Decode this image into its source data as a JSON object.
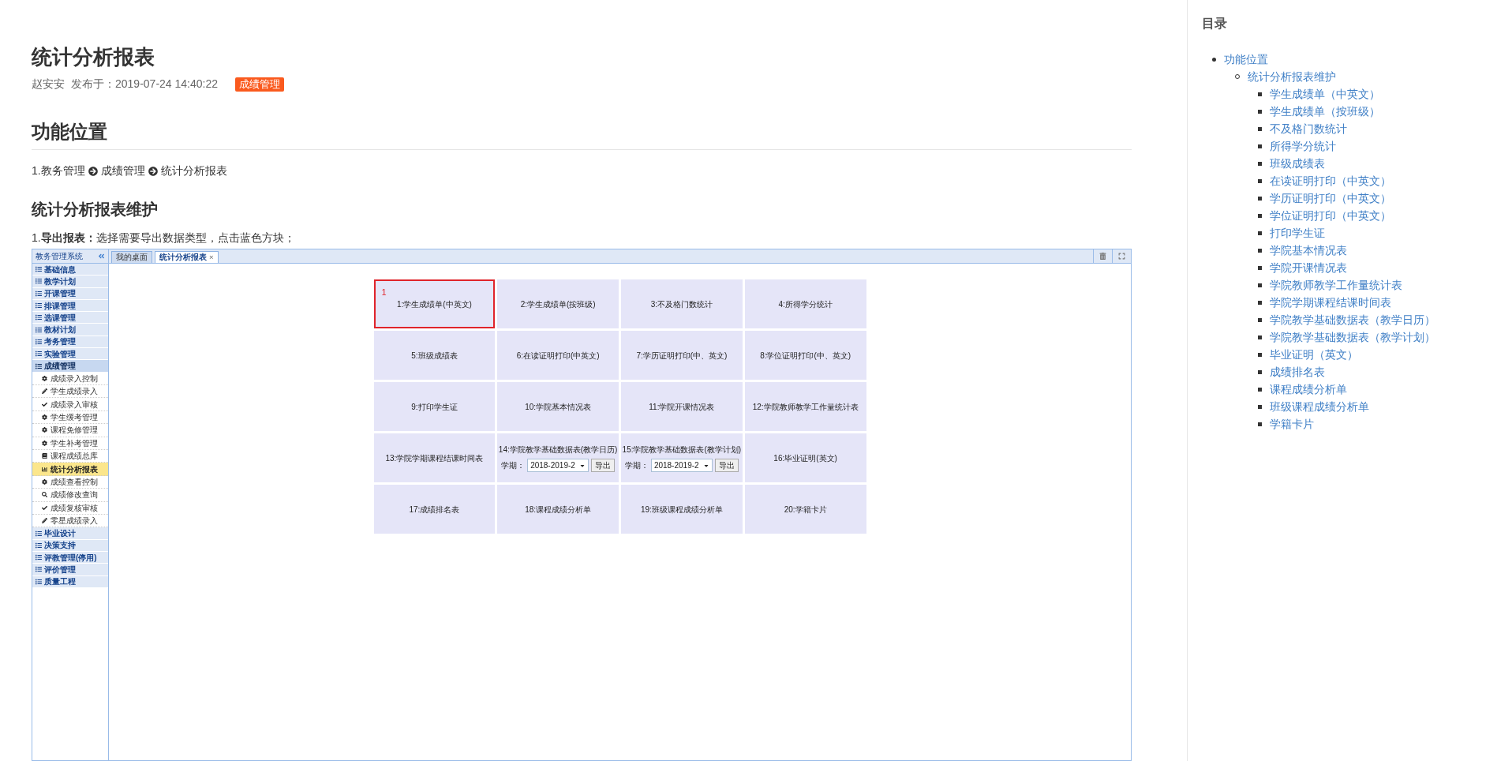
{
  "article": {
    "title": "统计分析报表",
    "author": "赵安安",
    "published": "发布于：2019-07-24 14:40:22",
    "tag": "成绩管理",
    "section": "功能位置",
    "breadcrumb": [
      "1.教务管理",
      "成绩管理",
      "统计分析报表"
    ],
    "subsection": "统计分析报表维护",
    "step": "1.**导出报表：**选择需要导出数据类型，点击蓝色方块；"
  },
  "screenshot": {
    "sidebar": {
      "title": "教务管理系统",
      "groups": [
        {
          "label": "基础信息",
          "expanded": false
        },
        {
          "label": "教学计划",
          "expanded": false
        },
        {
          "label": "开课管理",
          "expanded": false
        },
        {
          "label": "排课管理",
          "expanded": false
        },
        {
          "label": "选课管理",
          "expanded": false
        },
        {
          "label": "教材计划",
          "expanded": false
        },
        {
          "label": "考务管理",
          "expanded": false
        },
        {
          "label": "实验管理",
          "expanded": false
        },
        {
          "label": "成绩管理",
          "expanded": true,
          "children": [
            {
              "label": "成绩录入控制",
              "kind": "gear",
              "selected": false
            },
            {
              "label": "学生成绩录入",
              "kind": "pencil",
              "selected": false
            },
            {
              "label": "成绩录入审核",
              "kind": "check",
              "selected": false
            },
            {
              "label": "学生缓考管理",
              "kind": "gear",
              "selected": false
            },
            {
              "label": "课程免修管理",
              "kind": "gear",
              "selected": false
            },
            {
              "label": "学生补考管理",
              "kind": "gear",
              "selected": false
            },
            {
              "label": "课程成绩总库",
              "kind": "book",
              "selected": false
            },
            {
              "label": "统计分析报表",
              "kind": "chart",
              "selected": true
            },
            {
              "label": "成绩查看控制",
              "kind": "gear",
              "selected": false
            },
            {
              "label": "成绩修改查询",
              "kind": "search",
              "selected": false
            },
            {
              "label": "成绩复核审核",
              "kind": "check",
              "selected": false
            },
            {
              "label": "零星成绩录入",
              "kind": "pencil",
              "selected": false
            }
          ]
        },
        {
          "label": "毕业设计",
          "expanded": false
        },
        {
          "label": "决策支持",
          "expanded": false
        },
        {
          "label": "评教管理(停用)",
          "expanded": false
        },
        {
          "label": "评价管理",
          "expanded": false
        },
        {
          "label": "质量工程",
          "expanded": false
        }
      ]
    },
    "tabs": [
      {
        "label": "我的桌面",
        "selected": false
      },
      {
        "label": "统计分析报表",
        "selected": true,
        "close": "×"
      }
    ],
    "tiles": [
      {
        "label": "1:学生成绩单(中英文)",
        "highlighted": true,
        "marker": "1"
      },
      {
        "label": "2:学生成绩单(按班级)",
        "highlighted": false
      },
      {
        "label": "3:不及格门数统计",
        "highlighted": false
      },
      {
        "label": "4:所得学分统计",
        "highlighted": false
      },
      {
        "label": "5:班级成绩表",
        "highlighted": false
      },
      {
        "label": "6:在读证明打印(中英文)",
        "highlighted": false
      },
      {
        "label": "7:学历证明打印(中、英文)",
        "highlighted": false
      },
      {
        "label": "8:学位证明打印(中、英文)",
        "highlighted": false
      },
      {
        "label": "9:打印学生证",
        "highlighted": false
      },
      {
        "label": "10:学院基本情况表",
        "highlighted": false
      },
      {
        "label": "11:学院开课情况表",
        "highlighted": false
      },
      {
        "label": "12:学院教师教学工作量统计表",
        "highlighted": false
      },
      {
        "label": "13:学院学期课程结课时间表",
        "highlighted": false
      },
      {
        "label": "14:学院教学基础数据表(教学日历)",
        "highlighted": false,
        "term_label": "学期：",
        "term": "2018-2019-2",
        "button": "导出"
      },
      {
        "label": "15:学院教学基础数据表(教学计划)",
        "highlighted": false,
        "term_label": "学期：",
        "term": "2018-2019-2",
        "button": "导出"
      },
      {
        "label": "16:毕业证明(英文)",
        "highlighted": false
      },
      {
        "label": "17:成绩排名表",
        "highlighted": false
      },
      {
        "label": "18:课程成绩分析单",
        "highlighted": false
      },
      {
        "label": "19:班级课程成绩分析单",
        "highlighted": false
      },
      {
        "label": "20:学籍卡片",
        "highlighted": false
      }
    ]
  },
  "toc": {
    "title": "目录",
    "items": [
      {
        "label": "功能位置",
        "children": [
          {
            "label": "统计分析报表维护",
            "children": [
              {
                "label": "学生成绩单（中英文）"
              },
              {
                "label": "学生成绩单（按班级）"
              },
              {
                "label": "不及格门数统计"
              },
              {
                "label": "所得学分统计"
              },
              {
                "label": "班级成绩表"
              },
              {
                "label": "在读证明打印（中英文）"
              },
              {
                "label": "学历证明打印（中英文）"
              },
              {
                "label": "学位证明打印（中英文）"
              },
              {
                "label": "打印学生证"
              },
              {
                "label": "学院基本情况表"
              },
              {
                "label": "学院开课情况表"
              },
              {
                "label": "学院教师教学工作量统计表"
              },
              {
                "label": "学院学期课程结课时间表"
              },
              {
                "label": "学院教学基础数据表（教学日历）"
              },
              {
                "label": "学院教学基础数据表（教学计划）"
              },
              {
                "label": "毕业证明（英文）"
              },
              {
                "label": "成绩排名表"
              },
              {
                "label": "课程成绩分析单"
              },
              {
                "label": "班级课程成绩分析单"
              },
              {
                "label": "学籍卡片"
              }
            ]
          }
        ]
      }
    ]
  }
}
